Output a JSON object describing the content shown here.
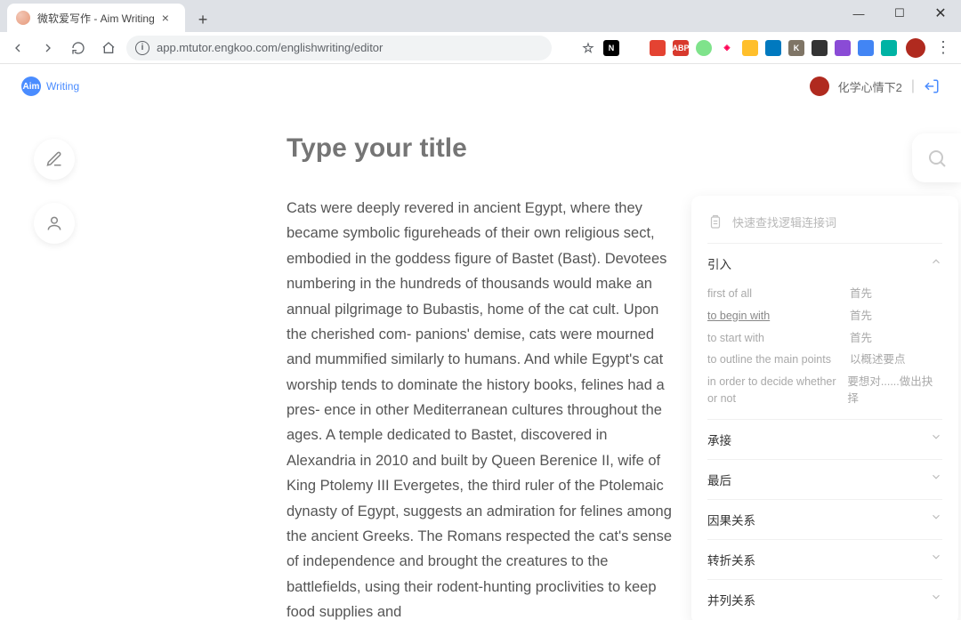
{
  "browser": {
    "tab_title": "微软爱写作 - Aim Writing",
    "url": "app.mtutor.engkoo.com/englishwriting/editor"
  },
  "extensions": [
    {
      "name": "translate",
      "bg": "#6b6b6b",
      "label": ""
    },
    {
      "name": "star",
      "bg": "",
      "label": "☆"
    },
    {
      "name": "notion",
      "bg": "#000",
      "label": "N"
    },
    {
      "name": "evernote",
      "bg": "#fff",
      "label": "",
      "color": "#2dbe60"
    },
    {
      "name": "todoist",
      "bg": "#e44332",
      "label": ""
    },
    {
      "name": "adblock",
      "bg": "#d8392d",
      "label": "ABP"
    },
    {
      "name": "green-dot",
      "bg": "#7fe38b",
      "label": ""
    },
    {
      "name": "diamond",
      "bg": "#fff",
      "label": "◈",
      "color": "#f05"
    },
    {
      "name": "yellow",
      "bg": "#ffbf2b",
      "label": ""
    },
    {
      "name": "trello",
      "bg": "#0079bf",
      "label": ""
    },
    {
      "name": "k",
      "bg": "#7f7566",
      "label": "K"
    },
    {
      "name": "qr",
      "bg": "#333",
      "label": ""
    },
    {
      "name": "purple",
      "bg": "#8a4bd6",
      "label": ""
    },
    {
      "name": "gtranslate",
      "bg": "#4285f4",
      "label": ""
    },
    {
      "name": "teal",
      "bg": "#00b3a4",
      "label": ""
    }
  ],
  "app": {
    "logo_badge": "Aim",
    "logo_text": "Writing",
    "user_name": "化学心情下2"
  },
  "editor": {
    "title_placeholder": "Type your title",
    "body": "Cats were deeply revered in ancient Egypt, where they became symbolic figureheads of their own religious sect, embodied in the goddess figure of Bastet (Bast). Devotees numbering in the hundreds of thousands would make an annual pilgrimage to Bubastis, home of the cat cult. Upon the cherished com- panions' demise, cats were mourned and mummified similarly to humans. And while Egypt's cat worship tends to dominate the history books, felines had a pres- ence in other Mediterranean cultures throughout the ages. A temple dedicated to Bastet, discovered in Alexandria in 2010 and built by Queen Berenice II, wife of King Ptolemy III Evergetes, the third ruler of the Ptolemaic dynasty of Egypt, suggests an admiration for felines among the ancient Greeks. The Romans respected the cat's sense of independence and brought the creatures to the battlefields, using their rodent-hunting proclivities to keep food supplies and"
  },
  "panel": {
    "hint": "快速查找逻辑连接词",
    "sections": [
      {
        "title": "引入",
        "open": true,
        "rows": [
          {
            "en": "first of all",
            "zh": "首先",
            "link": false
          },
          {
            "en": "to begin with",
            "zh": "首先",
            "link": true
          },
          {
            "en": "to start with",
            "zh": "首先",
            "link": false
          },
          {
            "en": "to outline the main points",
            "zh": "以概述要点",
            "link": false
          },
          {
            "en": "in order to decide whether or not",
            "zh": "要想对......做出抉择",
            "link": false
          }
        ]
      },
      {
        "title": "承接",
        "open": false,
        "rows": []
      },
      {
        "title": "最后",
        "open": false,
        "rows": []
      },
      {
        "title": "因果关系",
        "open": false,
        "rows": []
      },
      {
        "title": "转折关系",
        "open": false,
        "rows": []
      },
      {
        "title": "并列关系",
        "open": false,
        "rows": []
      }
    ]
  }
}
